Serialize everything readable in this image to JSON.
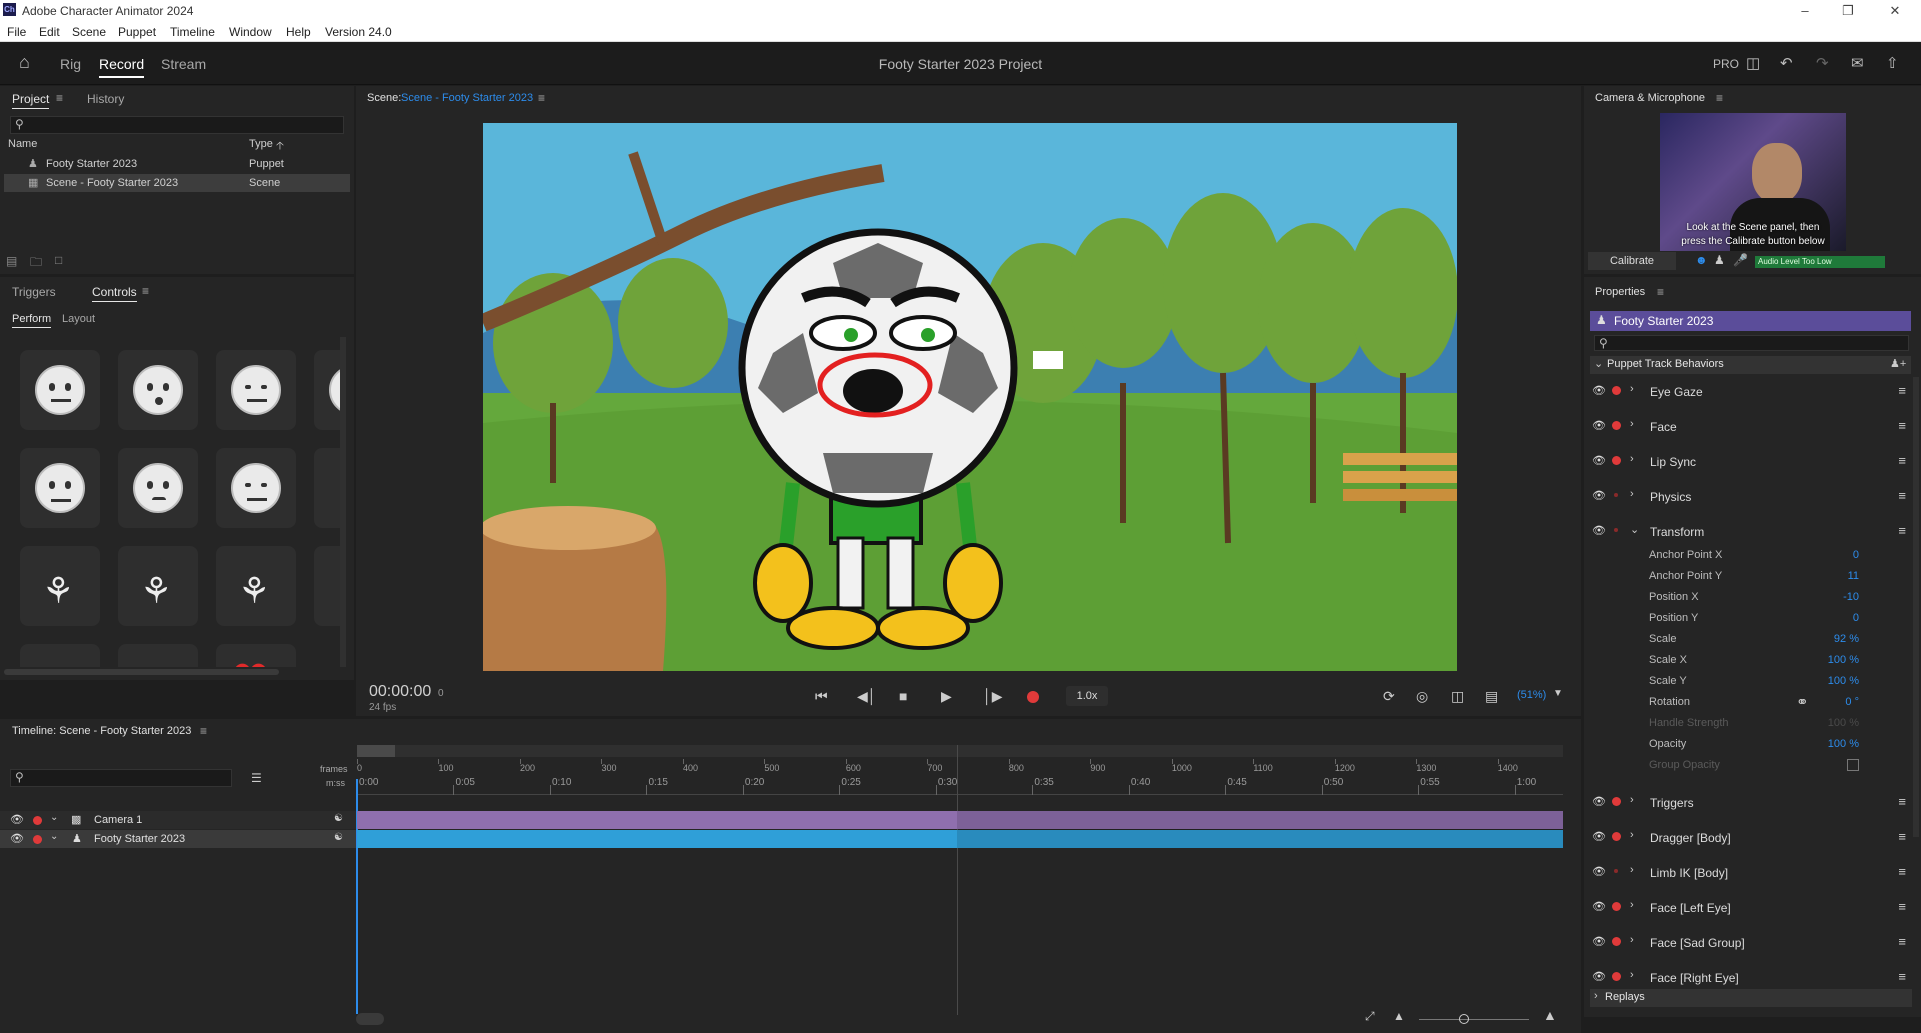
{
  "app": {
    "window_title": "Adobe Character Animator 2024",
    "logo_text": "Ch",
    "project_title": "Footy Starter 2023 Project"
  },
  "menu": [
    "File",
    "Edit",
    "Scene",
    "Puppet",
    "Timeline",
    "Window",
    "Help",
    "Version 24.0"
  ],
  "mode_tabs": {
    "rig": "Rig",
    "record": "Record",
    "stream": "Stream"
  },
  "header": {
    "pro_label": "PRO"
  },
  "project_panel": {
    "tab_project": "Project",
    "tab_history": "History",
    "col_name": "Name",
    "col_type": "Type",
    "items": [
      {
        "name": "Footy Starter 2023",
        "type": "Puppet"
      },
      {
        "name": "Scene - Footy Starter 2023",
        "type": "Scene"
      }
    ]
  },
  "controls_panel": {
    "tab_triggers": "Triggers",
    "tab_controls": "Controls",
    "sub_perform": "Perform",
    "sub_layout": "Layout"
  },
  "scene_panel": {
    "label": "Scene:",
    "scene_name": "Scene - Footy Starter 2023",
    "timecode": "00:00:00",
    "frame": "0",
    "fps": "24 fps",
    "speed": "1.0x",
    "zoom": "(51%)"
  },
  "camera_panel": {
    "title": "Camera & Microphone",
    "instruction_line1": "Look at the Scene panel, then",
    "instruction_line2": "press the Calibrate button below",
    "calibrate": "Calibrate",
    "audio_status": "Audio Level Too Low"
  },
  "properties": {
    "title": "Properties",
    "puppet": "Footy Starter 2023",
    "group": "Puppet Track Behaviors",
    "behaviors_top": [
      {
        "label": "Eye Gaze",
        "armed": true
      },
      {
        "label": "Face",
        "armed": true
      },
      {
        "label": "Lip Sync",
        "armed": true
      },
      {
        "label": "Physics",
        "armed": false
      }
    ],
    "transform": {
      "label": "Transform",
      "params": [
        {
          "label": "Anchor Point X",
          "value": "0"
        },
        {
          "label": "Anchor Point Y",
          "value": "11"
        },
        {
          "label": "Position X",
          "value": "-10"
        },
        {
          "label": "Position Y",
          "value": "0"
        },
        {
          "label": "Scale",
          "value": "92 %"
        },
        {
          "label": "Scale X",
          "value": "100 %"
        },
        {
          "label": "Scale Y",
          "value": "100 %"
        },
        {
          "label": "Rotation",
          "value": "0 °"
        },
        {
          "label": "Handle Strength",
          "value": "100 %"
        },
        {
          "label": "Opacity",
          "value": "100 %"
        },
        {
          "label": "Group Opacity",
          "value": ""
        }
      ]
    },
    "behaviors_bottom": [
      {
        "label": "Triggers",
        "armed": true
      },
      {
        "label": "Dragger [Body]",
        "armed": true
      },
      {
        "label": "Limb IK [Body]",
        "armed": false
      },
      {
        "label": "Face [Left Eye]",
        "armed": true
      },
      {
        "label": "Face [Sad Group]",
        "armed": true
      },
      {
        "label": "Face [Right Eye]",
        "armed": true
      }
    ],
    "replays": "Replays"
  },
  "timeline": {
    "title": "Timeline: Scene - Footy Starter 2023",
    "frames_label": "frames",
    "mss_label": "m:ss",
    "frame_ticks": [
      "0",
      "100",
      "200",
      "300",
      "400",
      "500",
      "600",
      "700",
      "800",
      "900",
      "1000",
      "1100",
      "1200",
      "1300",
      "1400"
    ],
    "time_ticks": [
      "0:00",
      "0:05",
      "0:10",
      "0:15",
      "0:20",
      "0:25",
      "0:30",
      "0:35",
      "0:40",
      "0:45",
      "0:50",
      "0:55",
      "1:00"
    ],
    "tracks": [
      {
        "name": "Camera 1",
        "color": "#8f6fae"
      },
      {
        "name": "Footy Starter 2023",
        "color": "#2f9fd8"
      }
    ]
  },
  "colors": {
    "accent": "#2d8ceb",
    "record": "#e03a3a",
    "puppet_header": "#5b4d9a"
  }
}
